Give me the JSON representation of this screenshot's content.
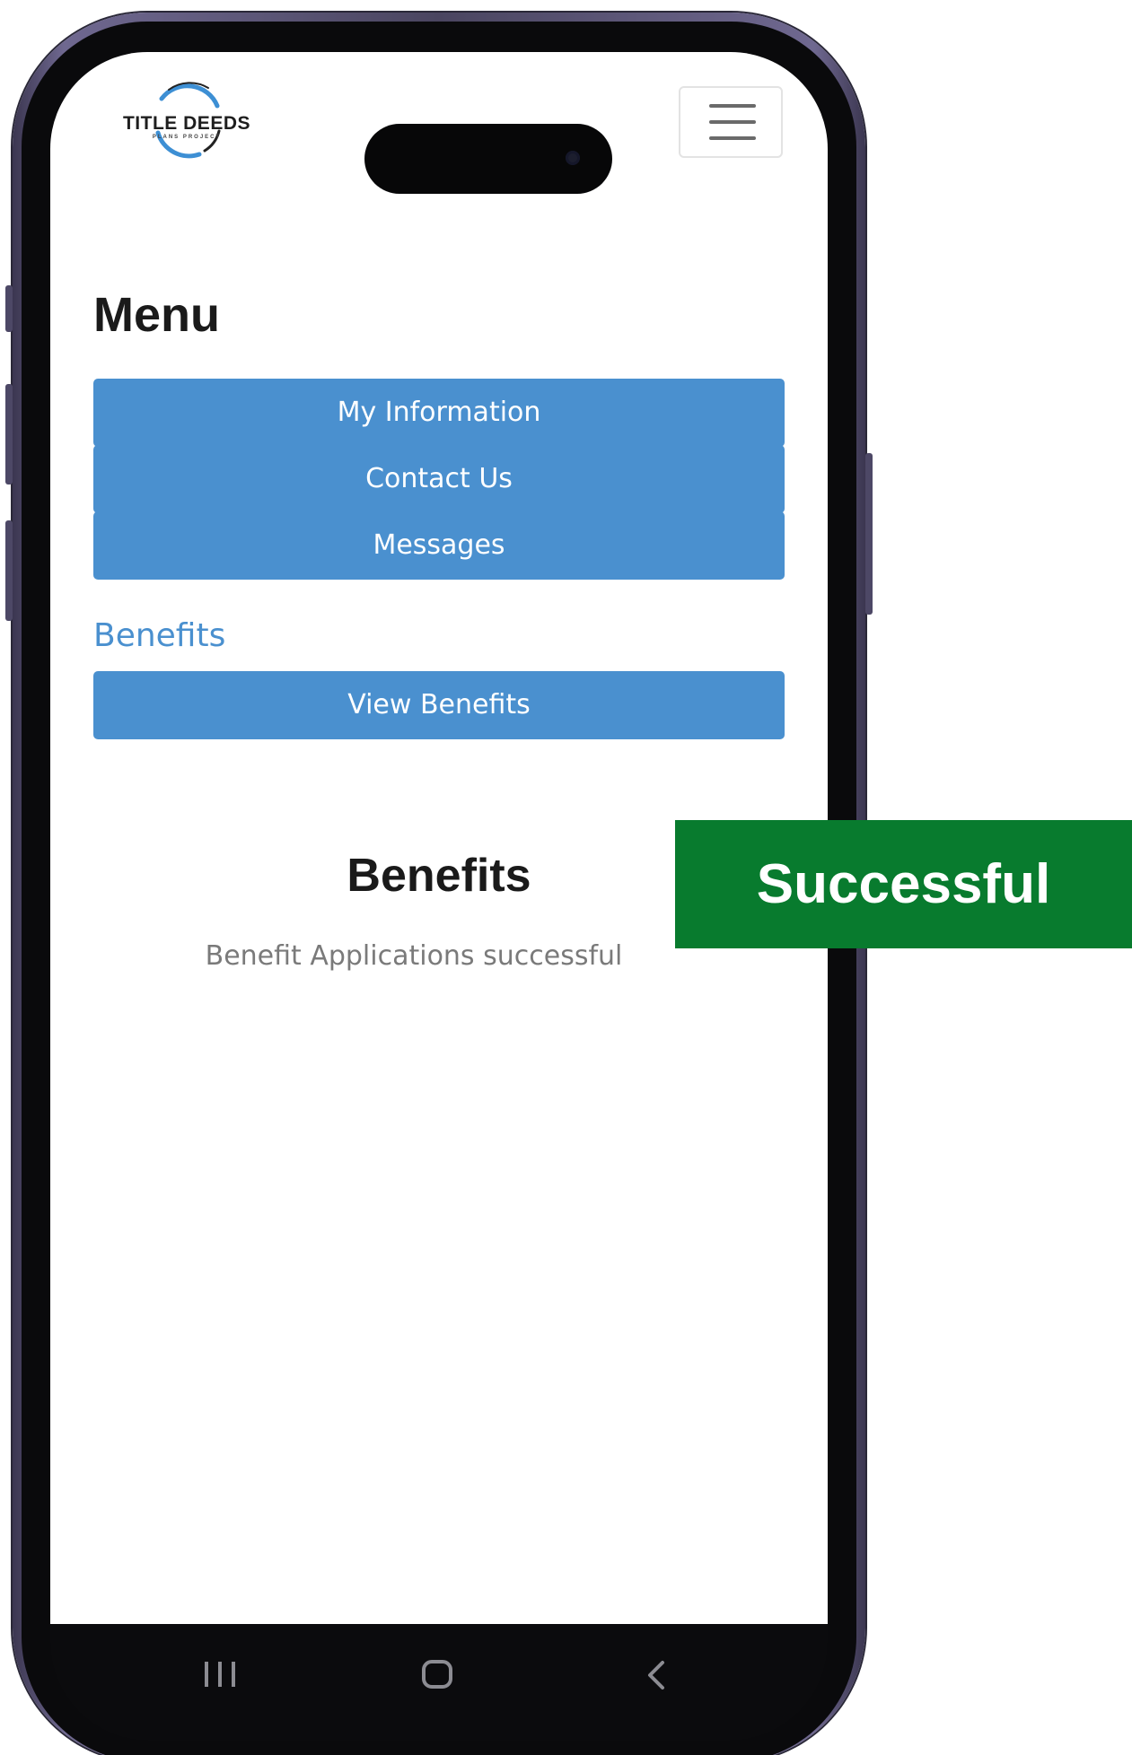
{
  "header": {
    "logo_text": "TITLE DEEDS",
    "logo_subtext": "PLANS PROJECT",
    "menu_toggle_icon": "hamburger-icon"
  },
  "menu": {
    "title": "Menu",
    "items": [
      {
        "label": "My Information"
      },
      {
        "label": "Contact Us"
      },
      {
        "label": "Messages"
      }
    ],
    "section_label": "Benefits",
    "section_items": [
      {
        "label": "View Benefits"
      }
    ]
  },
  "content": {
    "heading": "Benefits",
    "message": "Benefit Applications successful"
  },
  "system_nav": {
    "recents_icon": "recents-icon",
    "home_icon": "home-icon",
    "back_icon": "back-icon"
  },
  "badge": {
    "text": "Successful",
    "color": "#087b2e"
  },
  "colors": {
    "accent": "#4a90cf",
    "heading": "#1a1a1a",
    "muted_text": "#7a7a7a"
  }
}
